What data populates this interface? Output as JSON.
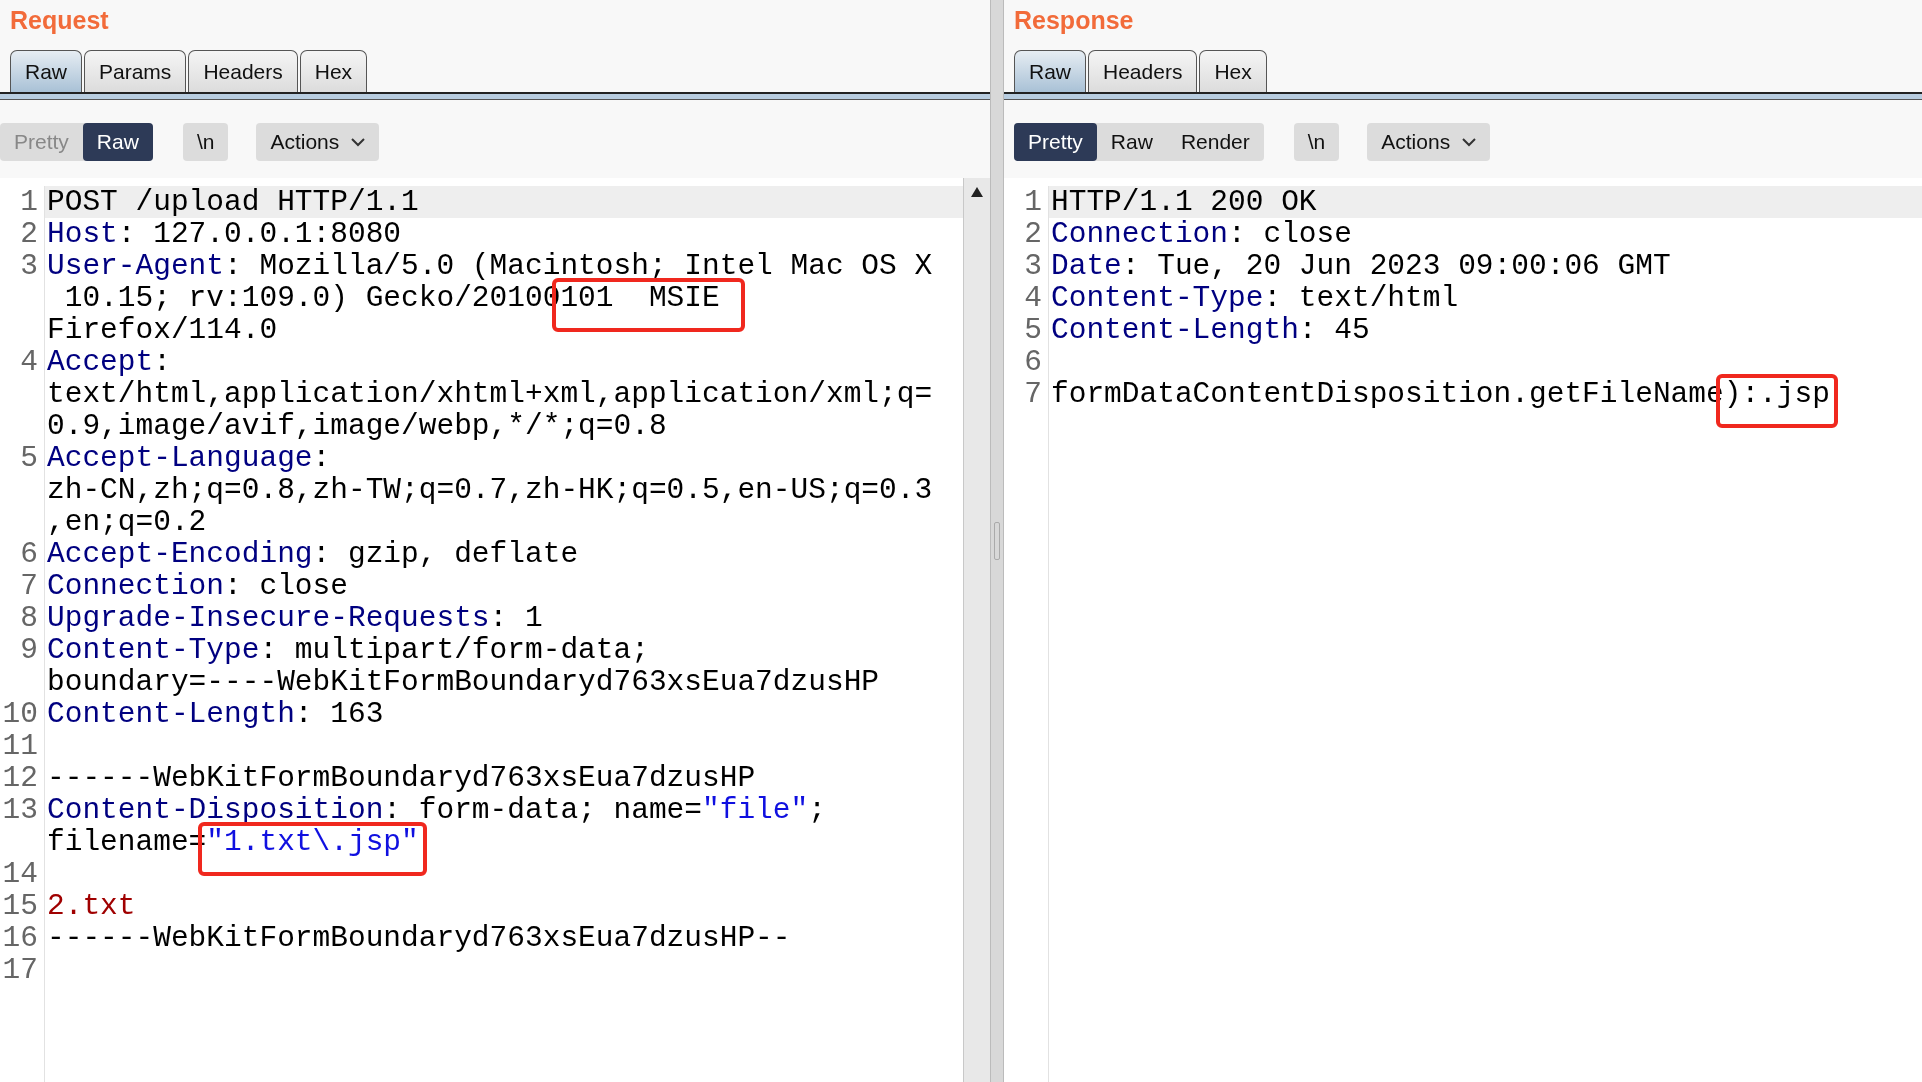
{
  "panels": [
    {
      "title": "Request",
      "tabs": [
        {
          "label": "Raw",
          "selected": true
        },
        {
          "label": "Params",
          "selected": false
        },
        {
          "label": "Headers",
          "selected": false
        },
        {
          "label": "Hex",
          "selected": false
        }
      ],
      "view_modes": [
        {
          "label": "Pretty",
          "selected": false
        },
        {
          "label": "Raw",
          "selected": true
        }
      ],
      "newline_button": "\\n",
      "actions_button": "Actions",
      "scrollbar": true,
      "lines": [
        {
          "number": "1",
          "current": true,
          "rows": [
            [
              {
                "kind": "text",
                "text": "POST /upload HTTP/1.1",
                "highlight": false
              }
            ]
          ]
        },
        {
          "number": "2",
          "current": false,
          "rows": [
            [
              {
                "kind": "key",
                "text": "Host",
                "highlight": false
              },
              {
                "kind": "text",
                "text": ": 127.0.0.1:8080",
                "highlight": false
              }
            ]
          ]
        },
        {
          "number": "3",
          "current": false,
          "rows": [
            [
              {
                "kind": "key",
                "text": "User-Agent",
                "highlight": false
              },
              {
                "kind": "text",
                "text": ": Mozilla/5.0 (Macintosh; Intel Mac OS X",
                "highlight": false
              }
            ],
            [
              {
                "kind": "text",
                "text": " 10.15; rv:109.0) Gecko/20100",
                "highlight": false
              },
              {
                "kind": "text",
                "text": "101  MSIE ",
                "highlight": true
              }
            ],
            [
              {
                "kind": "text",
                "text": "Firefox/114.0",
                "highlight": false
              }
            ]
          ]
        },
        {
          "number": "4",
          "current": false,
          "rows": [
            [
              {
                "kind": "key",
                "text": "Accept",
                "highlight": false
              },
              {
                "kind": "text",
                "text": ":",
                "highlight": false
              }
            ],
            [
              {
                "kind": "text",
                "text": "text/html,application/xhtml+xml,application/xml;q=",
                "highlight": false
              }
            ],
            [
              {
                "kind": "text",
                "text": "0.9,image/avif,image/webp,*/*;q=0.8",
                "highlight": false
              }
            ]
          ]
        },
        {
          "number": "5",
          "current": false,
          "rows": [
            [
              {
                "kind": "key",
                "text": "Accept-Language",
                "highlight": false
              },
              {
                "kind": "text",
                "text": ":",
                "highlight": false
              }
            ],
            [
              {
                "kind": "text",
                "text": "zh-CN,zh;q=0.8,zh-TW;q=0.7,zh-HK;q=0.5,en-US;q=0.3",
                "highlight": false
              }
            ],
            [
              {
                "kind": "text",
                "text": ",en;q=0.2",
                "highlight": false
              }
            ]
          ]
        },
        {
          "number": "6",
          "current": false,
          "rows": [
            [
              {
                "kind": "key",
                "text": "Accept-Encoding",
                "highlight": false
              },
              {
                "kind": "text",
                "text": ": gzip, deflate",
                "highlight": false
              }
            ]
          ]
        },
        {
          "number": "7",
          "current": false,
          "rows": [
            [
              {
                "kind": "key",
                "text": "Connection",
                "highlight": false
              },
              {
                "kind": "text",
                "text": ": close",
                "highlight": false
              }
            ]
          ]
        },
        {
          "number": "8",
          "current": false,
          "rows": [
            [
              {
                "kind": "key",
                "text": "Upgrade-Insecure-Requests",
                "highlight": false
              },
              {
                "kind": "text",
                "text": ": 1",
                "highlight": false
              }
            ]
          ]
        },
        {
          "number": "9",
          "current": false,
          "rows": [
            [
              {
                "kind": "key",
                "text": "Content-Type",
                "highlight": false
              },
              {
                "kind": "text",
                "text": ": multipart/form-data;",
                "highlight": false
              }
            ],
            [
              {
                "kind": "text",
                "text": "boundary=----WebKitFormBoundaryd763xsEua7dzusHP",
                "highlight": false
              }
            ]
          ]
        },
        {
          "number": "10",
          "current": false,
          "rows": [
            [
              {
                "kind": "key",
                "text": "Content-Length",
                "highlight": false
              },
              {
                "kind": "text",
                "text": ": 163",
                "highlight": false
              }
            ]
          ]
        },
        {
          "number": "11",
          "current": false,
          "rows": [
            []
          ]
        },
        {
          "number": "12",
          "current": false,
          "rows": [
            [
              {
                "kind": "text",
                "text": "------WebKitFormBoundaryd763xsEua7dzusHP",
                "highlight": false
              }
            ]
          ]
        },
        {
          "number": "13",
          "current": false,
          "rows": [
            [
              {
                "kind": "key",
                "text": "Content-Disposition",
                "highlight": false
              },
              {
                "kind": "text",
                "text": ": form-data; name=",
                "highlight": false
              },
              {
                "kind": "string",
                "text": "\"file\"",
                "highlight": false
              },
              {
                "kind": "text",
                "text": ";",
                "highlight": false
              }
            ],
            [
              {
                "kind": "text",
                "text": "filename=",
                "highlight": false
              },
              {
                "kind": "string",
                "text": "\"1.txt\\.jsp\"",
                "highlight": true
              }
            ]
          ]
        },
        {
          "number": "14",
          "current": false,
          "rows": [
            []
          ]
        },
        {
          "number": "15",
          "current": false,
          "rows": [
            [
              {
                "kind": "body",
                "text": "2.txt",
                "highlight": false
              }
            ]
          ]
        },
        {
          "number": "16",
          "current": false,
          "rows": [
            [
              {
                "kind": "text",
                "text": "------WebKitFormBoundaryd763xsEua7dzusHP--",
                "highlight": false
              }
            ]
          ]
        },
        {
          "number": "17",
          "current": false,
          "rows": [
            []
          ]
        }
      ]
    },
    {
      "title": "Response",
      "tabs": [
        {
          "label": "Raw",
          "selected": true
        },
        {
          "label": "Headers",
          "selected": false
        },
        {
          "label": "Hex",
          "selected": false
        }
      ],
      "view_modes": [
        {
          "label": "Pretty",
          "selected": true
        },
        {
          "label": "Raw",
          "selected": false
        },
        {
          "label": "Render",
          "selected": false
        }
      ],
      "newline_button": "\\n",
      "actions_button": "Actions",
      "scrollbar": false,
      "lines": [
        {
          "number": "1",
          "current": true,
          "rows": [
            [
              {
                "kind": "text",
                "text": "HTTP/1.1 200 OK",
                "highlight": false
              }
            ]
          ]
        },
        {
          "number": "2",
          "current": false,
          "rows": [
            [
              {
                "kind": "key",
                "text": "Connection",
                "highlight": false
              },
              {
                "kind": "text",
                "text": ": close",
                "highlight": false
              }
            ]
          ]
        },
        {
          "number": "3",
          "current": false,
          "rows": [
            [
              {
                "kind": "key",
                "text": "Date",
                "highlight": false
              },
              {
                "kind": "text",
                "text": ": Tue, 20 Jun 2023 09:00:06 GMT",
                "highlight": false
              }
            ]
          ]
        },
        {
          "number": "4",
          "current": false,
          "rows": [
            [
              {
                "kind": "key",
                "text": "Content-Type",
                "highlight": false
              },
              {
                "kind": "text",
                "text": ": text/html",
                "highlight": false
              }
            ]
          ]
        },
        {
          "number": "5",
          "current": false,
          "rows": [
            [
              {
                "kind": "key",
                "text": "Content-Length",
                "highlight": false
              },
              {
                "kind": "text",
                "text": ": 45",
                "highlight": false
              }
            ]
          ]
        },
        {
          "number": "6",
          "current": false,
          "rows": [
            []
          ]
        },
        {
          "number": "7",
          "current": false,
          "rows": [
            [
              {
                "kind": "text",
                "text": "formDataContentDisposition.getFileName",
                "highlight": false
              },
              {
                "kind": "text",
                "text": "):.jsp",
                "highlight": true
              }
            ]
          ]
        }
      ]
    }
  ]
}
